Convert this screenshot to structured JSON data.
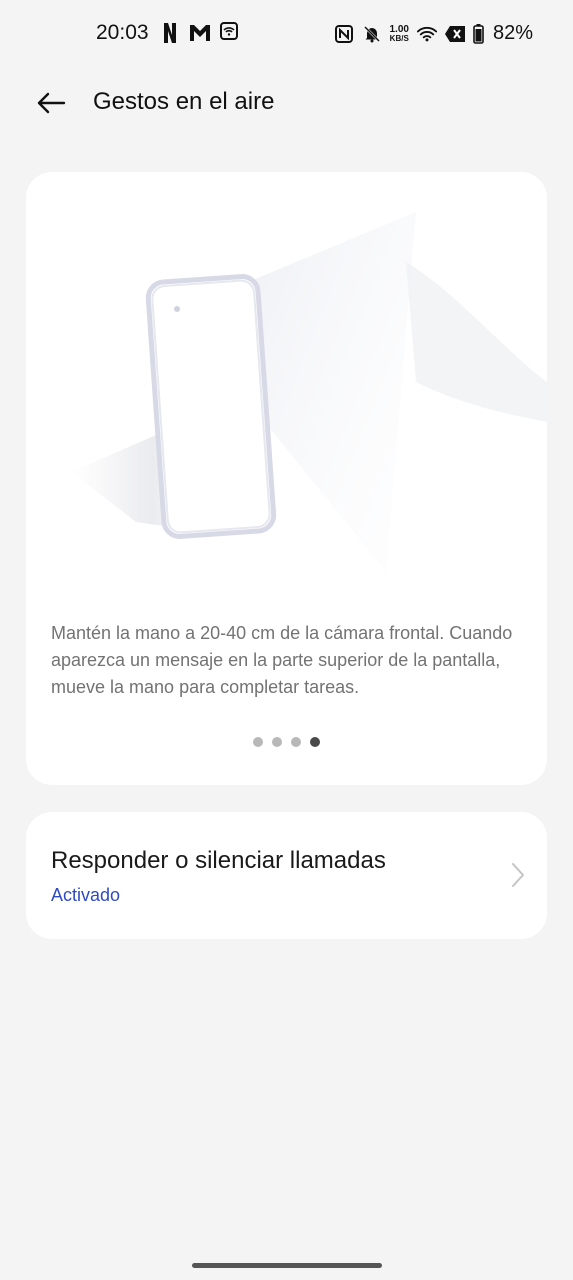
{
  "status_bar": {
    "time": "20:03",
    "left_icons": [
      "netflix-icon",
      "gmail-icon",
      "wifi-hotspot-icon"
    ],
    "right_icons": [
      "nfc-icon",
      "bell-muted-icon",
      "wifi-icon",
      "no-sim-icon",
      "battery-icon"
    ],
    "net_speed_value": "1.00",
    "net_speed_unit": "KB/S",
    "battery_percent": "82%"
  },
  "header": {
    "title": "Gestos en el aire"
  },
  "intro_card": {
    "description": "Mantén la mano a 20-40 cm de la cámara frontal. Cuando aparezca un mensaje en la parte superior de la pantalla, mueve la mano para completar tareas.",
    "page_count": 4,
    "active_page": 4
  },
  "settings": {
    "answer_calls": {
      "title": "Responder o silenciar llamadas",
      "status": "Activado"
    }
  },
  "colors": {
    "background": "#f4f4f4",
    "card": "#ffffff",
    "accent": "#2f4bc3"
  }
}
